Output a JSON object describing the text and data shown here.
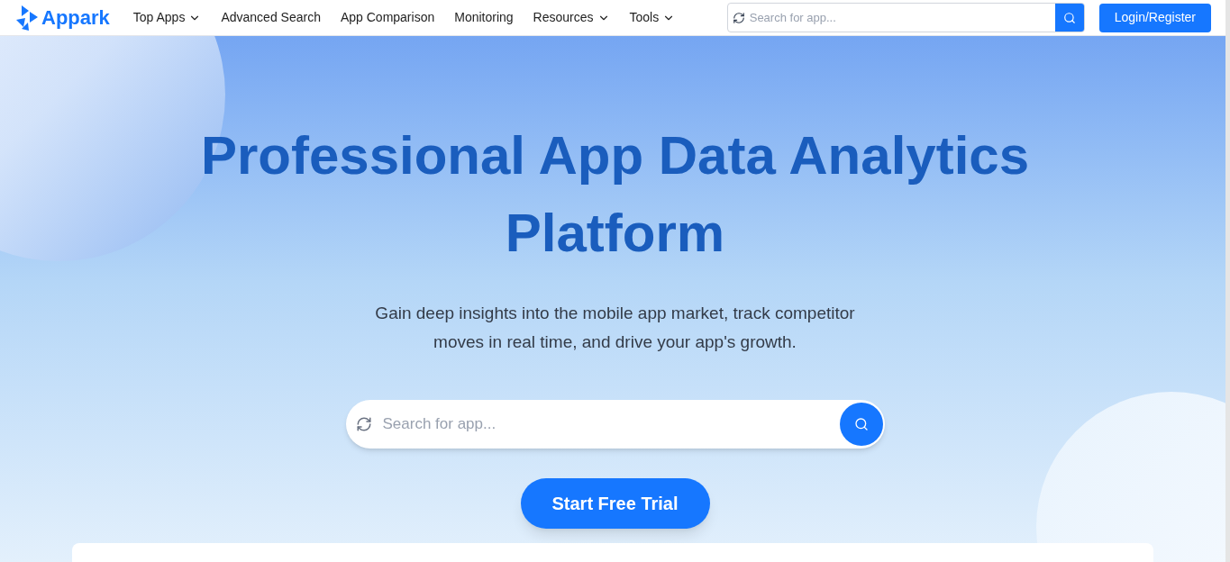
{
  "brand": "Appark",
  "nav": [
    {
      "label": "Top Apps",
      "dropdown": true
    },
    {
      "label": "Advanced Search",
      "dropdown": false
    },
    {
      "label": "App Comparison",
      "dropdown": false
    },
    {
      "label": "Monitoring",
      "dropdown": false
    },
    {
      "label": "Resources",
      "dropdown": true
    },
    {
      "label": "Tools",
      "dropdown": true
    }
  ],
  "header_search": {
    "placeholder": "Search for app..."
  },
  "login_button": "Login/Register",
  "hero": {
    "title": "Professional App Data Analytics Platform",
    "subtitle": "Gain deep insights into the mobile app market, track competitor moves in real time, and drive your app's growth.",
    "search": {
      "placeholder": "Search for app..."
    },
    "cta": "Start Free Trial"
  }
}
